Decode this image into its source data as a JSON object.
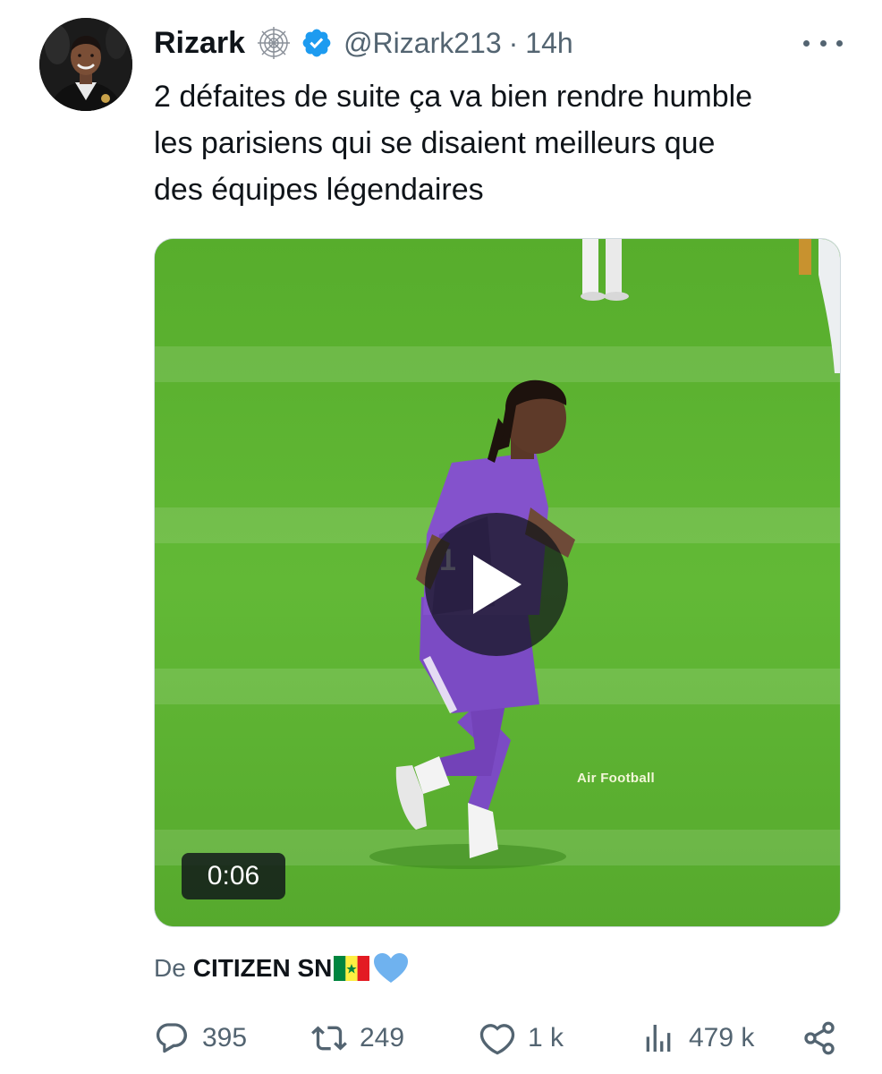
{
  "author": {
    "display_name": "Rizark",
    "handle": "@Rizark213",
    "time": "14h",
    "separator": "·",
    "badges": [
      "spider-web-icon",
      "verified-icon"
    ]
  },
  "tweet": {
    "text_lines": [
      "2 défaites de suite ça va bien rendre humble",
      "les parisiens qui se disaient meilleurs que",
      "des équipes légendaires"
    ]
  },
  "media": {
    "type": "video",
    "duration": "0:06",
    "watermark": "Air Football",
    "jersey_number": "1"
  },
  "source": {
    "prefix": "De",
    "name": "CITIZEN SN",
    "emoji": [
      "senegal-flag-icon",
      "blue-heart-icon"
    ]
  },
  "actions": {
    "replies": "395",
    "retweets": "249",
    "likes": "1 k",
    "views": "479 k"
  },
  "colors": {
    "verified": "#1d9bf0",
    "secondary_text": "#536471",
    "pitch": "#5db332",
    "kit": "#7b4bc4"
  }
}
